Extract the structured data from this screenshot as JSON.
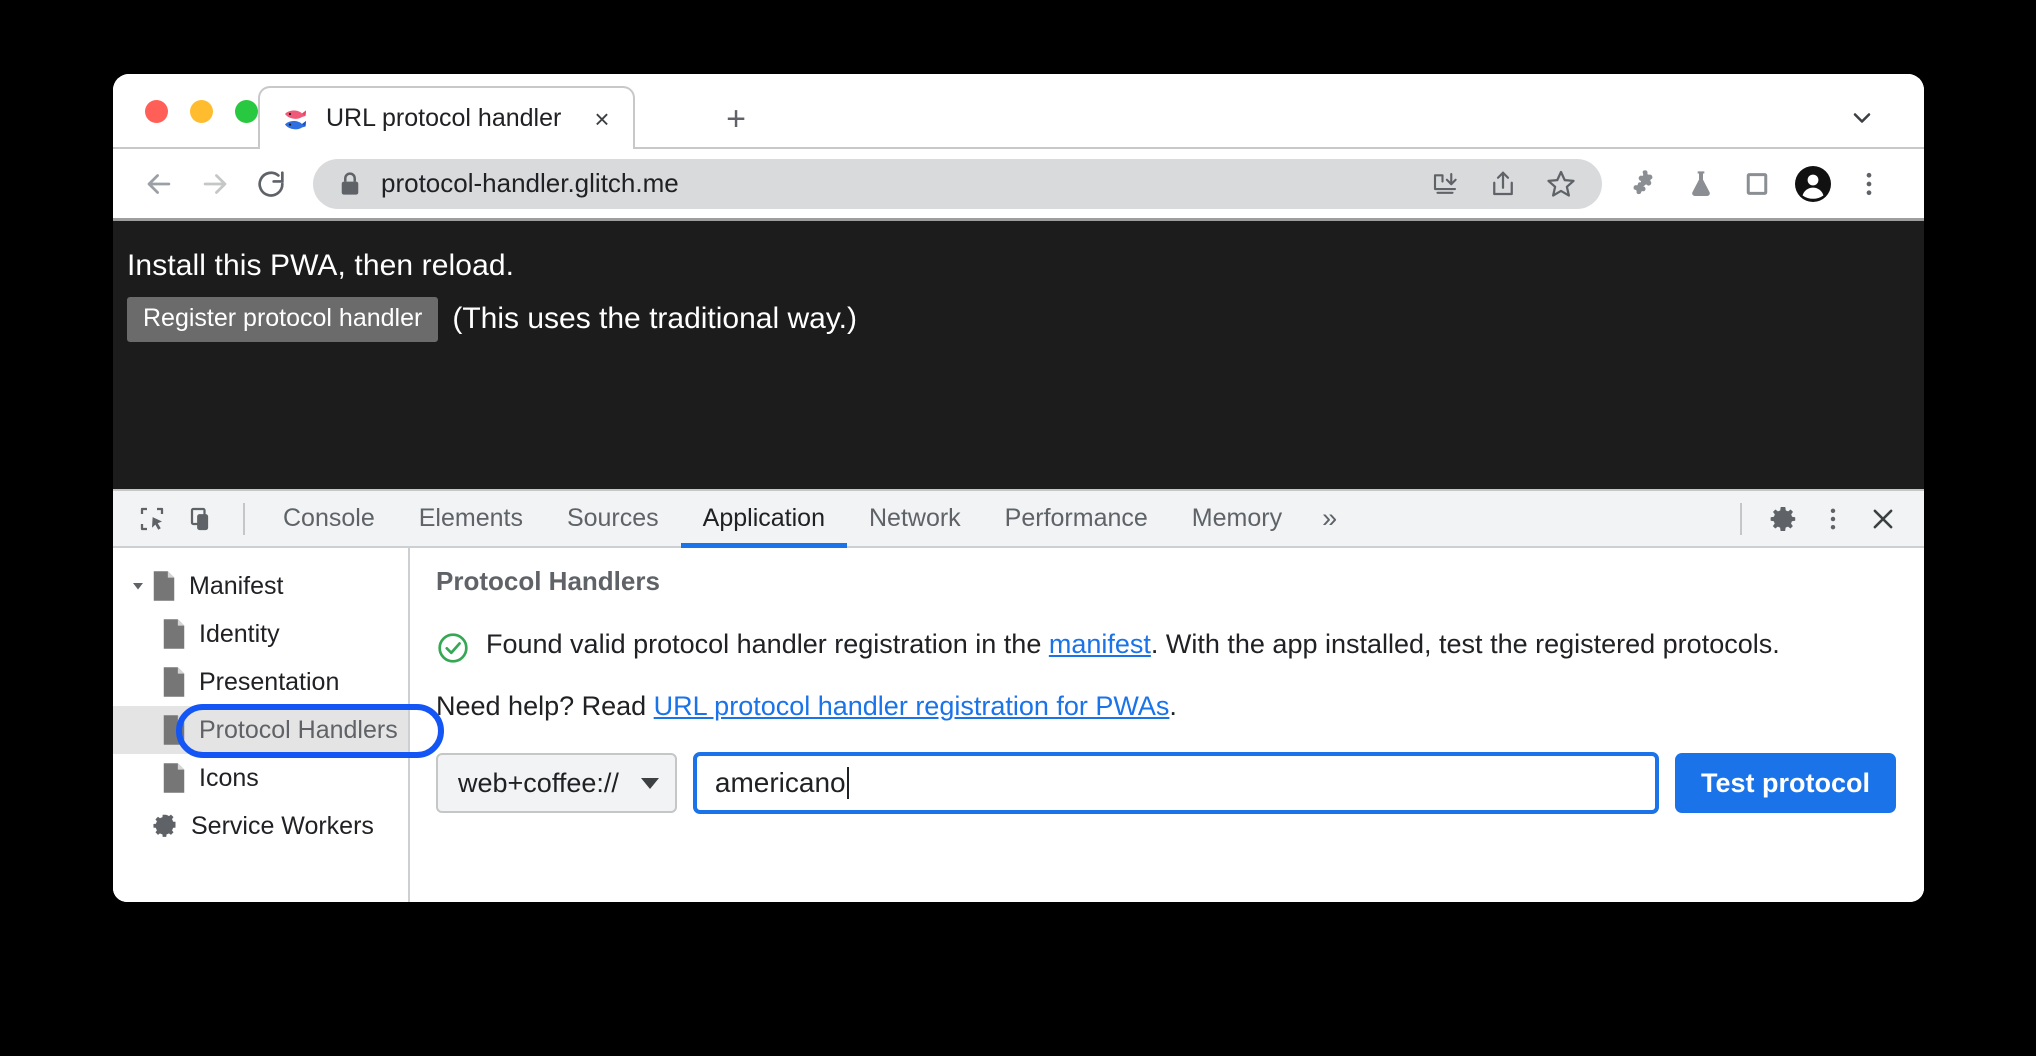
{
  "window": {
    "traffic_lights": [
      "close",
      "minimize",
      "maximize"
    ],
    "tab": {
      "title": "URL protocol handler",
      "favicon": "tropical-fish-icon",
      "close_label": "×"
    },
    "new_tab_label": "+",
    "tabstrip_chevron": "chevron-down-icon"
  },
  "toolbar": {
    "back": "back-arrow-icon",
    "forward": "forward-arrow-icon",
    "reload": "reload-icon",
    "lock": "lock-icon",
    "url": "protocol-handler.glitch.me",
    "omnibox_actions": [
      "install-pwa-icon",
      "share-icon",
      "bookmark-star-icon"
    ],
    "right_icons": [
      "extensions-puzzle-icon",
      "experiments-flask-icon",
      "side-panel-icon",
      "profile-avatar-icon",
      "browser-menu-icon"
    ]
  },
  "page": {
    "heading": "Install this PWA, then reload.",
    "register_button": "Register protocol handler",
    "note": "(This uses the traditional way.)"
  },
  "devtools": {
    "inspect_icon": "inspect-element-icon",
    "device_icon": "device-toolbar-icon",
    "tabs": [
      {
        "label": "Console",
        "active": false
      },
      {
        "label": "Elements",
        "active": false
      },
      {
        "label": "Sources",
        "active": false
      },
      {
        "label": "Application",
        "active": true
      },
      {
        "label": "Network",
        "active": false
      },
      {
        "label": "Performance",
        "active": false
      },
      {
        "label": "Memory",
        "active": false
      }
    ],
    "more_tabs": "»",
    "settings_icon": "gear-icon",
    "kebab_icon": "more-options-icon",
    "close_icon": "close-devtools-icon",
    "sidebar": [
      {
        "label": "Manifest",
        "icon": "manifest-doc-icon",
        "twisty": "expanded",
        "indent": 0,
        "selected": false
      },
      {
        "label": "Identity",
        "icon": "doc-icon",
        "twisty": "none",
        "indent": 1,
        "selected": false
      },
      {
        "label": "Presentation",
        "icon": "doc-icon",
        "twisty": "none",
        "indent": 1,
        "selected": false
      },
      {
        "label": "Protocol Handlers",
        "icon": "doc-icon",
        "twisty": "none",
        "indent": 1,
        "selected": true
      },
      {
        "label": "Icons",
        "icon": "doc-icon",
        "twisty": "none",
        "indent": 1,
        "selected": false
      },
      {
        "label": "Service Workers",
        "icon": "gear-icon",
        "twisty": "none",
        "indent": 0,
        "selected": false
      }
    ],
    "main": {
      "panel_title": "Protocol Handlers",
      "status_icon": "success-check-icon",
      "status_text_1": "Found valid protocol handler registration in the ",
      "status_link": "manifest",
      "status_text_2": ". With the app installed, test the registered protocols.",
      "help_prefix": "Need help? Read ",
      "help_link": "URL protocol handler registration for PWAs",
      "help_suffix": ".",
      "protocol_select_value": "web+coffee://",
      "protocol_input_value": "americano",
      "protocol_input_placeholder": "",
      "test_button": "Test protocol"
    }
  },
  "colors": {
    "accent_blue": "#1a73e8",
    "highlight_ring": "#1355f5",
    "success_green": "#34a853",
    "page_background": "#1c1c1c",
    "devtools_background": "#f1f3f4"
  }
}
